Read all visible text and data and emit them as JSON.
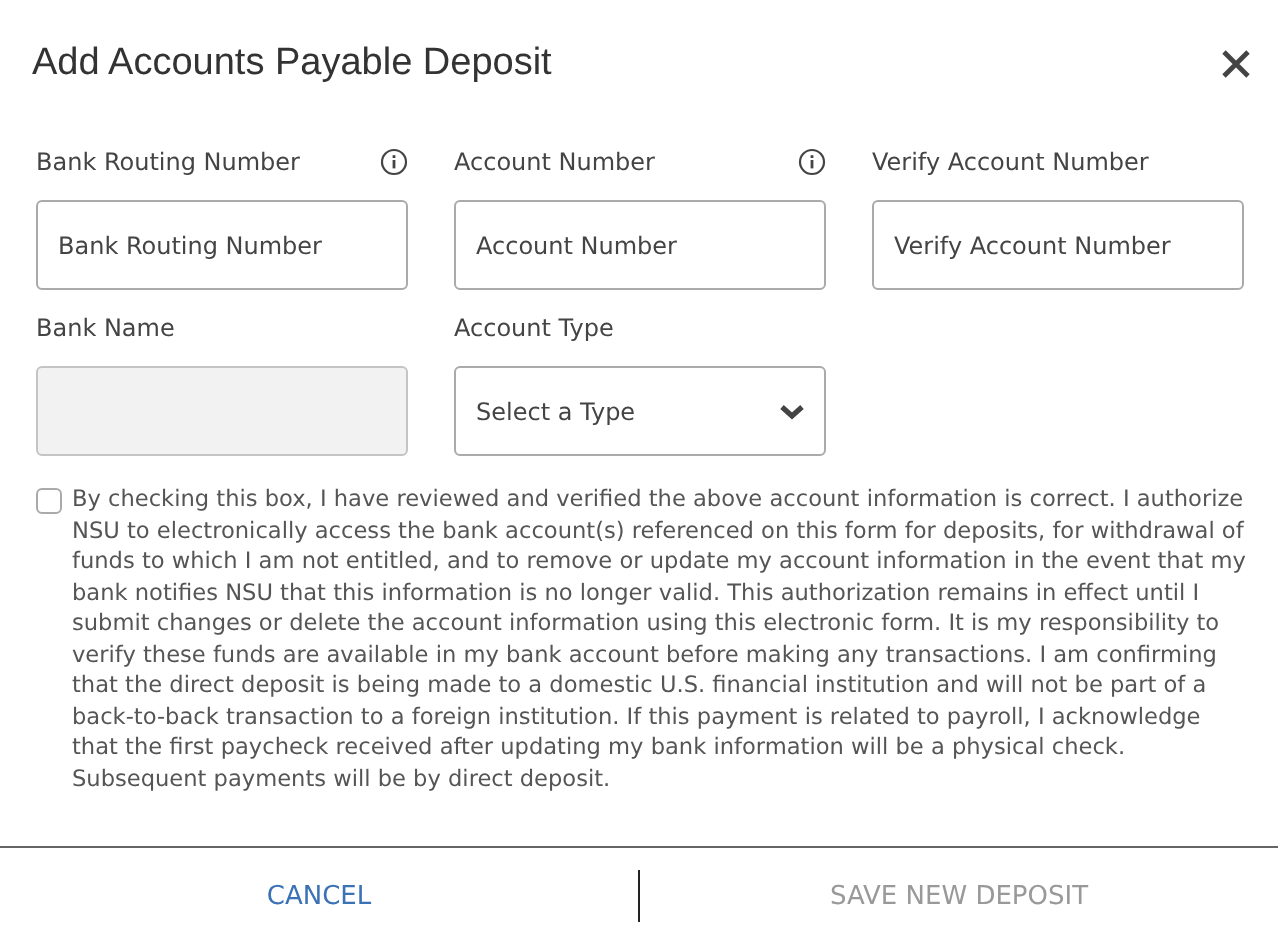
{
  "dialog": {
    "title": "Add Accounts Payable Deposit"
  },
  "fields": [
    {
      "kind": "input",
      "label": "Bank Routing Number",
      "placeholder": "Bank Routing Number",
      "info": true,
      "disabled": false
    },
    {
      "kind": "input",
      "label": "Account Number",
      "placeholder": "Account Number",
      "info": true,
      "disabled": false
    },
    {
      "kind": "input",
      "label": "Verify Account Number",
      "placeholder": "Verify Account Number",
      "info": false,
      "disabled": false
    },
    {
      "kind": "input",
      "label": "Bank Name",
      "info": false,
      "disabled": true
    },
    {
      "kind": "select",
      "label": "Account Type",
      "value": "Select a Type",
      "info": false,
      "disabled": false
    }
  ],
  "agreement": {
    "checked": false,
    "text": "By checking this box, I have reviewed and verified the above account information is correct. I authorize NSU to electronically access the bank account(s) referenced on this form for deposits, for withdrawal of funds to which I am not entitled, and to remove or update my account information in the event that my bank notifies NSU that this information is no longer valid. This authorization remains in effect until I submit changes or delete the account information using this electronic form. It is my responsibility to verify these funds are available in my bank account before making any transactions. I am confirming that the direct deposit is being made to a domestic U.S. financial institution and will not be part of a back-to-back transaction to a foreign institution. If this payment is related to payroll, I acknowledge that the first paycheck received after updating my bank information will be a physical check. Subsequent payments will be by direct deposit."
  },
  "buttons": [
    {
      "label": "CANCEL",
      "disabled": false
    },
    {
      "label": "SAVE NEW DEPOSIT",
      "disabled": true
    }
  ]
}
